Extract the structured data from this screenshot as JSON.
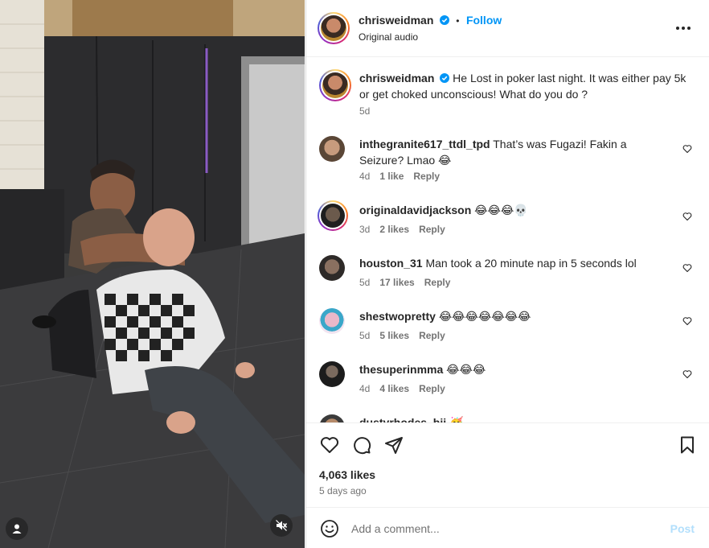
{
  "header": {
    "username": "chrisweidman",
    "follow_label": "Follow",
    "separator": "•",
    "audio": "Original audio",
    "more_icon": "more-horizontal-icon"
  },
  "caption": {
    "username": "chrisweidman",
    "text": "He Lost in poker last night. It was either pay 5k or get choked unconscious! What do you do ?",
    "time": "5d"
  },
  "comments": [
    {
      "username": "inthegranite617_ttdl_tpd",
      "text": "That’s was Fugazi! Fakin a Seizure? Lmao 😂",
      "time": "4d",
      "likes": "1 like",
      "reply": "Reply"
    },
    {
      "username": "originaldavidjackson",
      "text": "😂😂😂💀",
      "time": "3d",
      "likes": "2 likes",
      "reply": "Reply"
    },
    {
      "username": "houston_31",
      "text": "Man took a 20 minute nap in 5 seconds lol",
      "time": "5d",
      "likes": "17 likes",
      "reply": "Reply"
    },
    {
      "username": "shestwopretty",
      "text": "😂😂😂😂😂😂😂",
      "time": "5d",
      "likes": "5 likes",
      "reply": "Reply"
    },
    {
      "username": "thesuperinmma",
      "text": "😂😂😂",
      "time": "4d",
      "likes": "4 likes",
      "reply": "Reply"
    },
    {
      "username": "dustyrhodes_bji",
      "text": "🥳"
    }
  ],
  "actions": {
    "likes": "4,063 likes",
    "posted": "5 days ago"
  },
  "add_comment": {
    "placeholder": "Add a comment...",
    "post_label": "Post"
  },
  "colors": {
    "accent": "#0095f6",
    "post_disabled": "#b2dffc",
    "muted": "#737373",
    "text": "#262626"
  }
}
